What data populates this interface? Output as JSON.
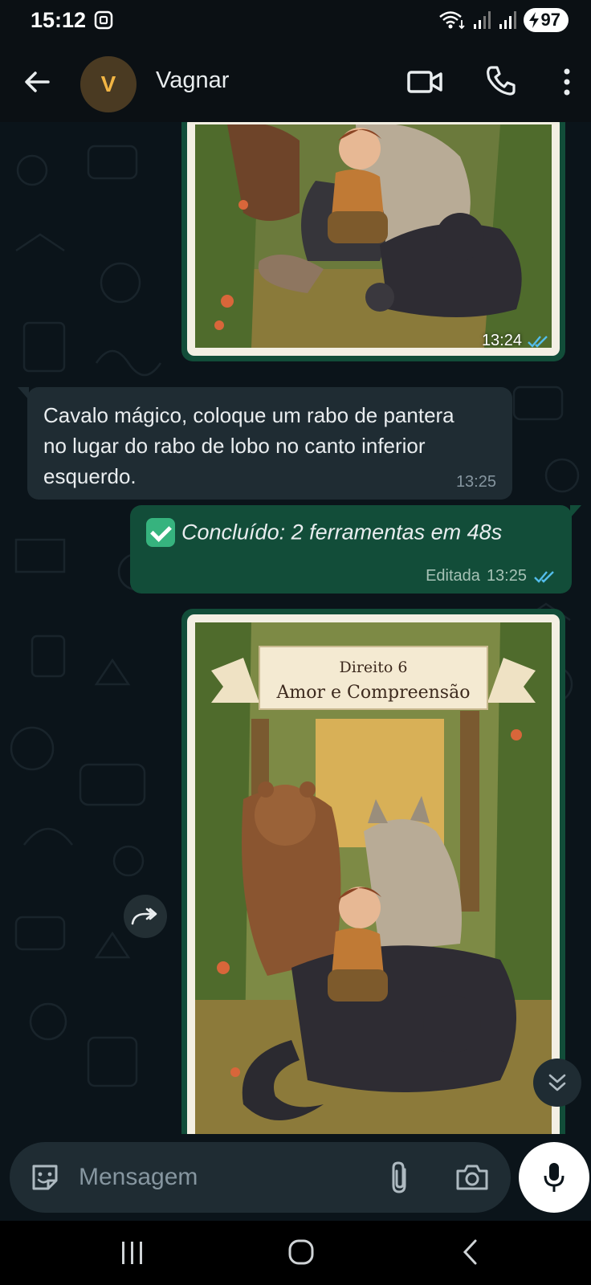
{
  "status_bar": {
    "time": "15:12",
    "battery": "97",
    "icons": [
      "screen-record-icon",
      "wifi-icon",
      "signal-icon",
      "signal-icon",
      "battery-charging-icon"
    ]
  },
  "header": {
    "contact_initial": "V",
    "contact_name": "Vagnar",
    "icons": [
      "back-arrow-icon",
      "video-call-icon",
      "voice-call-icon",
      "more-vert-icon"
    ]
  },
  "messages": [
    {
      "type": "image",
      "direction": "outgoing",
      "time": "13:24",
      "read": true,
      "icon": "double-check-icon"
    },
    {
      "type": "text",
      "direction": "incoming",
      "text": "Cavalo mágico, coloque um rabo de pantera no lugar do rabo de lobo no canto inferior esquerdo.",
      "time": "13:25"
    },
    {
      "type": "text",
      "direction": "outgoing",
      "emoji": "check-mark-button-icon",
      "text": "Concluído: 2 ferramentas em 48s",
      "edited_label": "Editada",
      "time": "13:25",
      "read": true
    },
    {
      "type": "image",
      "direction": "outgoing",
      "banner_line1": "Direito 6",
      "banner_line2": "Amor e Compreensão"
    }
  ],
  "composer": {
    "placeholder": "Mensagem",
    "icons": [
      "sticker-icon",
      "attach-icon",
      "camera-icon",
      "mic-icon"
    ]
  },
  "nav_bar": {
    "icons": [
      "recents-icon",
      "home-icon",
      "back-icon"
    ]
  },
  "colors": {
    "background": "#0b141a",
    "incoming_bubble": "#1f2c33",
    "outgoing_bubble": "#124d39",
    "read_ticks": "#53bdeb",
    "avatar_letter": "#f2b544"
  }
}
